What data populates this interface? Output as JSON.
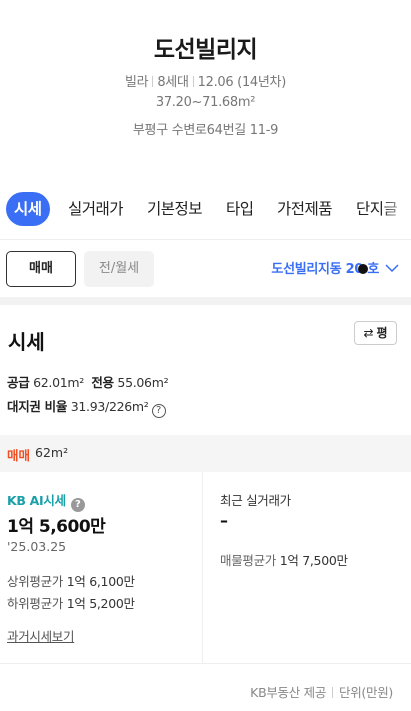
{
  "header": {
    "title": "도선빌리지",
    "building_type": "빌라",
    "households": "8세대",
    "built": "12.06 (14년차)",
    "area_range": "37.20~71.68m²",
    "address": "부평구 수변로64번길 11-9"
  },
  "tabs": [
    "시세",
    "실거래가",
    "기본정보",
    "타입",
    "가전제품",
    "단지글"
  ],
  "trade": {
    "sale_label": "매매",
    "rent_label": "전/월세",
    "unit_select": "도선빌리지동 20 호"
  },
  "sise": {
    "title": "시세",
    "pyeong_label": "평",
    "supply_label": "공급",
    "supply_value": "62.01m²",
    "exclusive_label": "전용",
    "exclusive_value": "55.06m²",
    "land_ratio_label": "대지권 비율",
    "land_ratio_value": "31.93/226m²"
  },
  "type_bar": {
    "deal": "매매",
    "size": "62m²"
  },
  "kb": {
    "label": "KB AI시세",
    "price": "1억 5,600만",
    "date": "'25.03.25",
    "upper_label": "상위평균가",
    "upper_value": "1억 6,100만",
    "lower_label": "하위평균가",
    "lower_value": "1억 5,200만",
    "past_link": "과거시세보기"
  },
  "recent": {
    "label": "최근 실거래가",
    "value": "–",
    "listing_avg_label": "매물평균가",
    "listing_avg_value": "1억 7,500만"
  },
  "footer": {
    "provider": "KB부동산 제공",
    "unit": "단위(만원)"
  },
  "colors": {
    "accent": "#3a6ff5",
    "kb_teal": "#1aa0a8",
    "deal_orange": "#f04e23"
  }
}
